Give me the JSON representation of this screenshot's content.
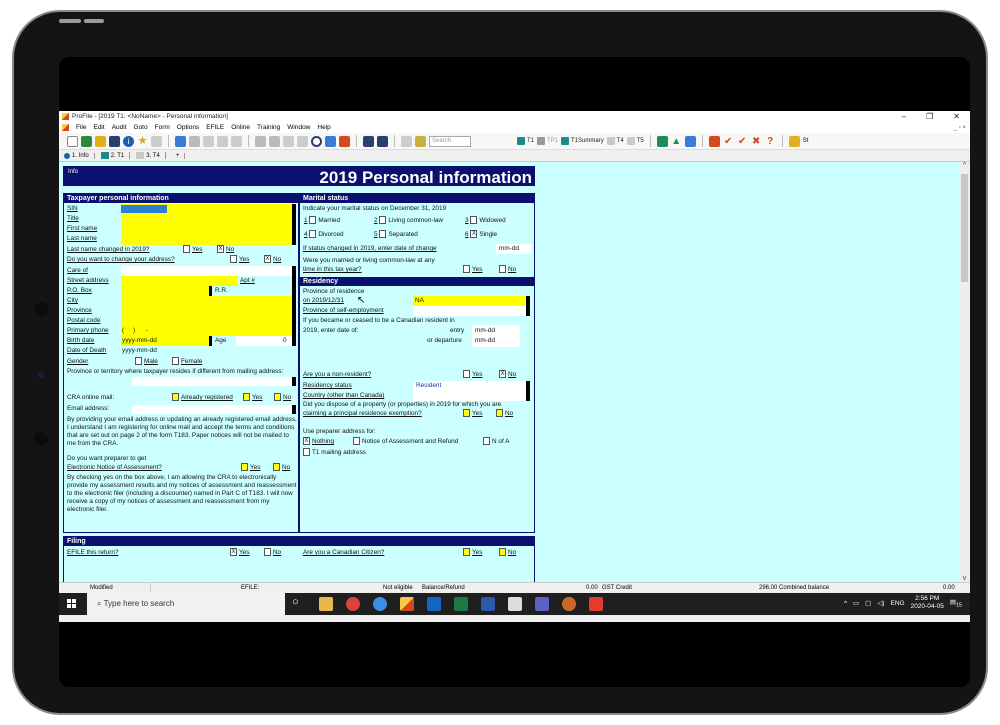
{
  "window": {
    "title": "ProFile - [2019 T1: <NoName> - Personal information]",
    "controls": {
      "minimize": "–",
      "restore": "❐",
      "close": "✕"
    },
    "mdi_controls": "_ ▫ ×"
  },
  "menu": [
    "File",
    "Edit",
    "Audit",
    "Goto",
    "Form",
    "Options",
    "EFILE",
    "Online",
    "Training",
    "Window",
    "Help"
  ],
  "toolbar": {
    "search_placeholder": "Search",
    "form_buttons": [
      "T1",
      "TP1",
      "T1Summary",
      "T4",
      "T5"
    ],
    "right_label": "St"
  },
  "tabs": [
    {
      "label": "1. Info",
      "icon": "info-icon"
    },
    {
      "label": "2. T1",
      "icon": "t1-form-icon"
    },
    {
      "label": "3. T4",
      "icon": "document-icon"
    },
    {
      "label": "+",
      "icon": ""
    }
  ],
  "form": {
    "info_label": "Info",
    "title": "2019 Personal information",
    "taxpayer": {
      "heading": "Taxpayer personal information",
      "sin": "SIN",
      "title": "Title",
      "first_name": "First name",
      "last_name": "Last name",
      "last_name_changed": "Last name changed in 2019?",
      "yes": "Yes",
      "no": "No",
      "change_address": "Do you want to change your address?",
      "care_of": "Care of",
      "street_address": "Street address",
      "apt": "Apt #",
      "po_box": "P.O. Box",
      "rr": "R.R.",
      "city": "City",
      "province": "Province",
      "postal_code": "Postal code",
      "primary_phone": "Primary phone",
      "phone_value": "(     )      -",
      "birth_date": "Birth date",
      "birth_value": "yyyy-mm-dd",
      "age": "Age",
      "age_value": "0",
      "date_of_death": "Date of Death",
      "death_value": "yyyy-mm-dd",
      "gender": "Gender",
      "male": "Male",
      "female": "Female",
      "province_reside": "Province or territory where taxpayer resides if different from mailing address:",
      "cra_online_mail": "CRA online mail:",
      "already_registered": "Already registered",
      "email_address": "Email address:",
      "email_disclaimer": "By providing your email address or updating an already registered email address, I understand I am registering for online mail and accept the terms and conditions that are set out on page 2 of the form T183. Paper notices will not be mailed to me from the CRA.",
      "preparer_notice_q1": "Do you want preparer to get",
      "preparer_notice_q2": "Electronic Notice of Assessment?",
      "notice_disclaimer": "By checking yes on the box above, I am allowing the CRA to electronically provide my assessment results and my notices of assessment and reassessment to the electronic filer (including a discounter) named in Part C of T183. I will now receive a copy of my notices of assessment and reassessment from my electronic filer."
    },
    "marital": {
      "heading": "Marital status",
      "prompt": "Indicate your marital status on December 31, 2019",
      "options": [
        {
          "num": "1",
          "label": "Married",
          "checked": false
        },
        {
          "num": "2",
          "label": "Living common-law",
          "checked": false
        },
        {
          "num": "3",
          "label": "Widowed",
          "checked": false
        },
        {
          "num": "4",
          "label": "Divorced",
          "checked": false
        },
        {
          "num": "5",
          "label": "Separated",
          "checked": false
        },
        {
          "num": "6",
          "label": "Single",
          "checked": true
        }
      ],
      "status_changed": "If status changed in 2019, enter date of change",
      "date_placeholder": "mm-dd",
      "married_q1": "Were you married or living common-law at any",
      "married_q2": "time in this tax year?",
      "yes": "Yes",
      "no": "No"
    },
    "residency": {
      "heading": "Residency",
      "province_label1": "Province of residence",
      "province_label2": "on 2019/12/31",
      "province_value": "NA",
      "self_employment": "Province of self-employment",
      "resident_q1": "If you became or ceased to be a Canadian resident in",
      "resident_q2": "2019, enter date of:",
      "entry": "entry",
      "departure": "or departure",
      "date_placeholder": "mm-dd",
      "non_resident": "Are you a non-resident?",
      "residency_status": "Residency status",
      "residency_status_value": "Resident",
      "country": "Country (other than Canada)",
      "dispose_q1": "Did you dispose of a property (or properties) in 2019 for which you are",
      "dispose_q2": "claiming a principal residence exemption?",
      "preparer_address": "Use preparer address for:",
      "nothing": "Nothing",
      "noa_refund": "Notice of Assessment and Refund",
      "n_of_a": "N of A",
      "t1_mailing": "T1 mailing address",
      "yes": "Yes",
      "no": "No"
    },
    "filing": {
      "heading": "Filing",
      "efile_q": "EFILE this return?",
      "citizen_q": "Are you a Canadian Citizen?",
      "yes": "Yes",
      "no": "No"
    }
  },
  "statusbar": {
    "modified": "Modified",
    "efile": "EFILE:",
    "not_eligible": "Not eligible",
    "balance_refund": "Balance/Refund",
    "balance_value": "0.00",
    "gst_credit": "GST Credit",
    "gst_value": "296.00",
    "combined_balance": "Combined balance",
    "combined_value": "0.00"
  },
  "taskbar": {
    "search_placeholder": "Type here to search",
    "language": "ENG",
    "time": "2:56 PM",
    "date": "2020-04-05",
    "notification_count": "15"
  }
}
